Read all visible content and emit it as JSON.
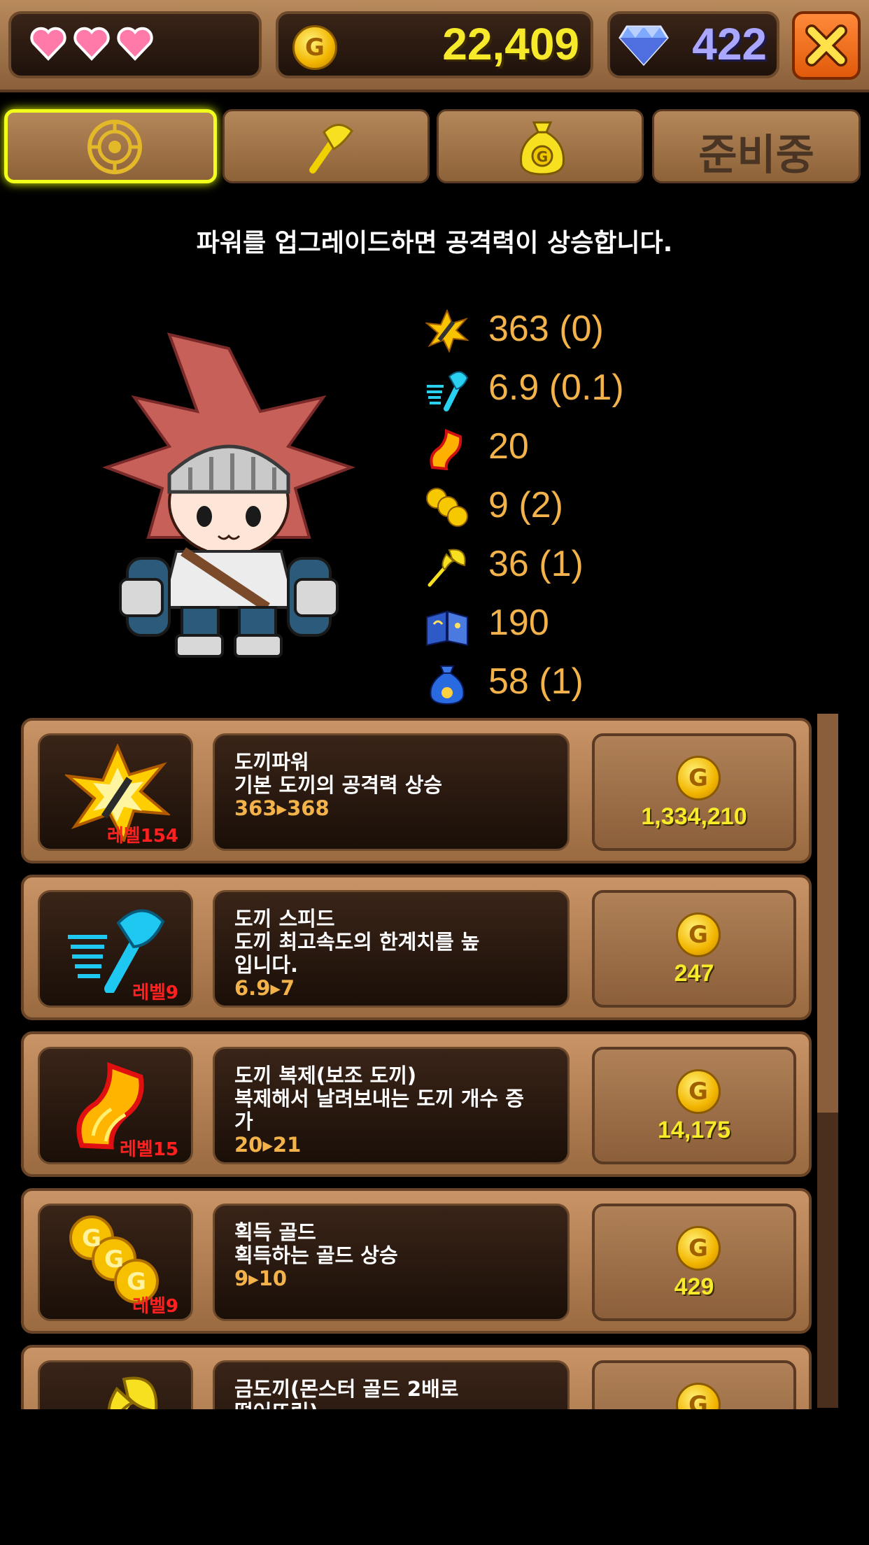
{
  "header": {
    "lives": 3,
    "gold_icon": "G",
    "gold": "22,409",
    "gems": "422"
  },
  "tabs": [
    {
      "name": "power",
      "label": ""
    },
    {
      "name": "axe",
      "label": ""
    },
    {
      "name": "money-bag",
      "label": ""
    },
    {
      "name": "coming-soon",
      "label": "준비중"
    }
  ],
  "description": "파워를 업그레이드하면 공격력이 상승합니다.",
  "stats": [
    {
      "icon": "attack-power-icon",
      "value": "363 (0)"
    },
    {
      "icon": "axe-speed-icon",
      "value": "6.9 (0.1)"
    },
    {
      "icon": "axe-clone-icon",
      "value": "20"
    },
    {
      "icon": "gold-coins-icon",
      "value": "9 (2)"
    },
    {
      "icon": "golden-axe-icon",
      "value": "36 (1)"
    },
    {
      "icon": "spellbook-icon",
      "value": "190"
    },
    {
      "icon": "potion-bag-icon",
      "value": "58 (1)"
    }
  ],
  "upgrades": [
    {
      "level": "레벨154",
      "name": "도끼파워",
      "desc": "기본 도끼의 공격력 상승",
      "range": "363▸368",
      "coin": "G",
      "price": "1,334,210"
    },
    {
      "level": "레벨9",
      "name": "도끼 스피드",
      "desc": "도끼 최고속도의 한계치를 높입니다.",
      "range": "6.9▸7",
      "coin": "G",
      "price": "247"
    },
    {
      "level": "레벨15",
      "name": "도끼 복제(보조 도끼)",
      "desc": "복제해서 날려보내는 도끼 개수 증가",
      "range": "20▸21",
      "coin": "G",
      "price": "14,175"
    },
    {
      "level": "레벨9",
      "name": "획득 골드",
      "desc": "획득하는 골드 상승",
      "range": "9▸10",
      "coin": "G",
      "price": "429"
    },
    {
      "level": "",
      "name": "금도끼(몬스터 골드 2배로",
      "desc": "떨어뜨림)",
      "range": "",
      "coin": "G",
      "price": ""
    }
  ],
  "colors": {
    "accent_gold": "#f7ea2a",
    "stat_orange": "#f3b34a",
    "level_red": "#ff2020",
    "gem_blue": "#a9a7ff"
  }
}
